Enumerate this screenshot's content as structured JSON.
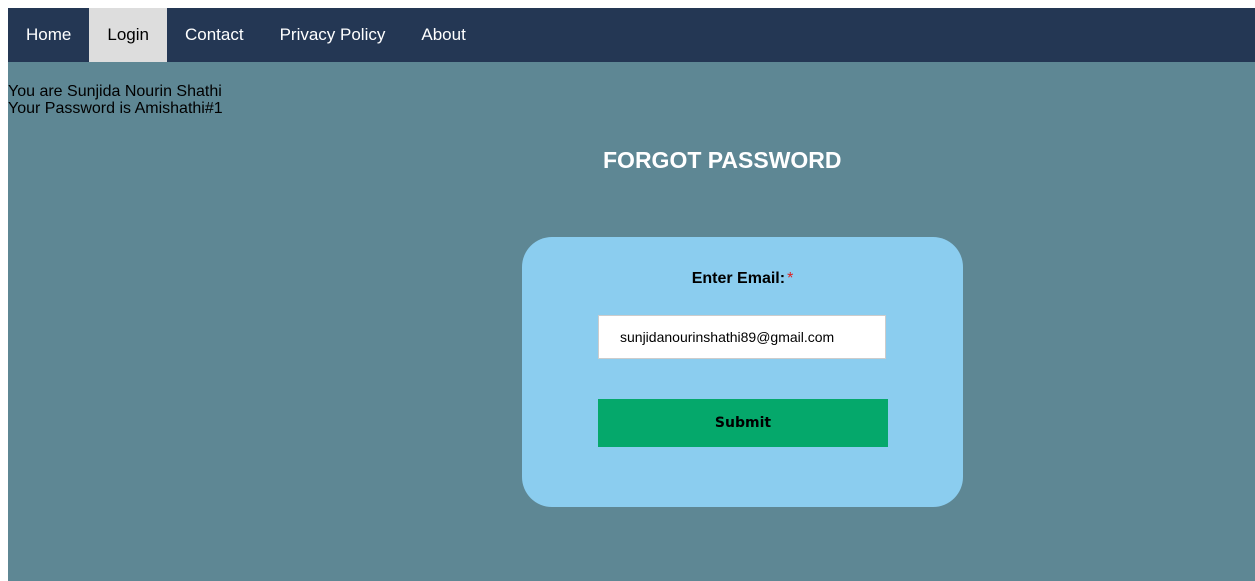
{
  "nav": {
    "items": [
      {
        "label": "Home",
        "active": false
      },
      {
        "label": "Login",
        "active": true
      },
      {
        "label": "Contact",
        "active": false
      },
      {
        "label": "Privacy Policy",
        "active": false
      },
      {
        "label": "About",
        "active": false
      }
    ]
  },
  "info": {
    "user_line": "You are Sunjida Nourin Shathi",
    "password_line": "Your Password is Amishathi#1"
  },
  "form": {
    "heading": "FORGOT PASSWORD",
    "email_label": "Enter Email:",
    "required_mark": "*",
    "email_value": "sunjidanourinshathi89@gmail.com",
    "submit_label": "Submit"
  },
  "colors": {
    "navbar": "#243754",
    "nav_active": "#dddddd",
    "page_background": "#5e8794",
    "card": "#8bcdef",
    "submit_button": "#05a86b",
    "required_mark": "#e02020"
  }
}
